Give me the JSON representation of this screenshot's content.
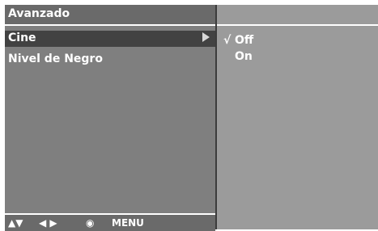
{
  "menu": {
    "title": "Avanzado",
    "items": [
      {
        "label": "Cine",
        "selected": true
      },
      {
        "label": "Nivel de Negro",
        "selected": false
      }
    ],
    "footer": {
      "up_down": "▲▼",
      "left_right": "◀ ▶",
      "ok": "◉",
      "menu": "MENU"
    }
  },
  "submenu": {
    "options": [
      {
        "label": "Off",
        "checked": true,
        "check_mark": "√"
      },
      {
        "label": "On",
        "checked": false,
        "check_mark": ""
      }
    ]
  },
  "colors": {
    "panel_left": "#7f7f7f",
    "panel_right": "#9b9b9b",
    "selected_item": "#424242",
    "text": "#ffffff"
  }
}
